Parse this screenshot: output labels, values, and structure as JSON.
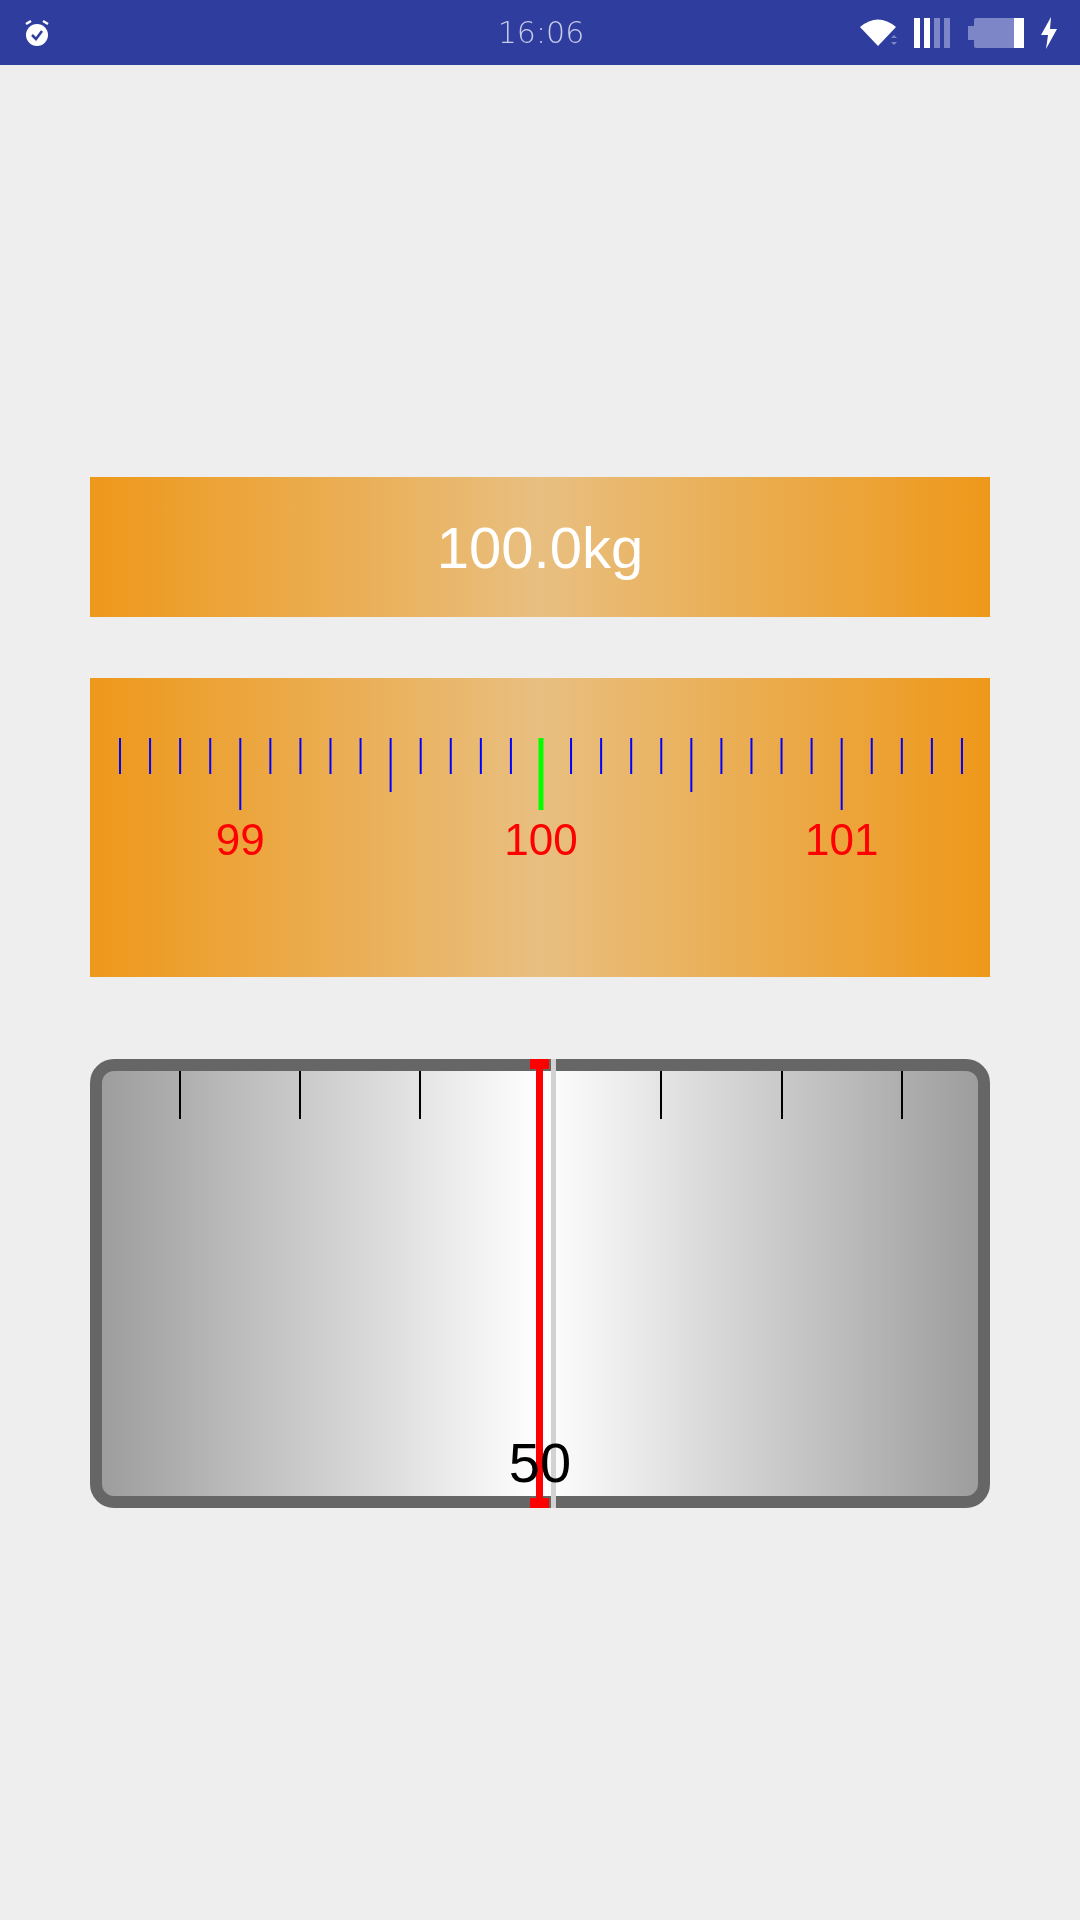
{
  "status_bar": {
    "time": "16:06"
  },
  "weight_display": {
    "text": "100.0kg"
  },
  "ruler": {
    "labels": [
      "99",
      "100",
      "101"
    ]
  },
  "gauge": {
    "label": "50"
  }
}
